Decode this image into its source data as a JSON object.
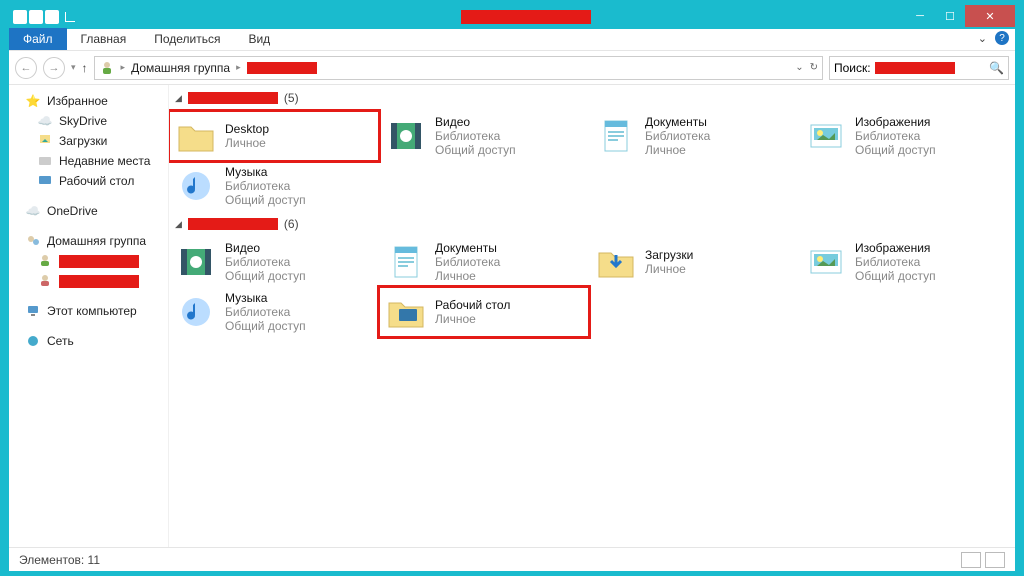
{
  "ribbon": {
    "file": "Файл",
    "tabs": [
      "Главная",
      "Поделиться",
      "Вид"
    ]
  },
  "breadcrumb": {
    "root": "Домашняя группа"
  },
  "search": {
    "label": "Поиск:"
  },
  "sidebar": {
    "fav": "Избранное",
    "favItems": [
      "SkyDrive",
      "Загрузки",
      "Недавние места",
      "Рабочий стол"
    ],
    "onedrive": "OneDrive",
    "hg": "Домашняя группа",
    "pc": "Этот компьютер",
    "net": "Сеть"
  },
  "groups": [
    {
      "count": "(5)",
      "items": [
        {
          "name": "Desktop",
          "l2": "Личное",
          "icon": "folder",
          "hl": true
        },
        {
          "name": "Видео",
          "l2": "Библиотека",
          "l3": "Общий доступ",
          "icon": "video"
        },
        {
          "name": "Документы",
          "l2": "Библиотека",
          "l3": "Личное",
          "icon": "doc"
        },
        {
          "name": "Изображения",
          "l2": "Библиотека",
          "l3": "Общий доступ",
          "icon": "img"
        },
        {
          "name": "Музыка",
          "l2": "Библиотека",
          "l3": "Общий доступ",
          "icon": "music"
        }
      ]
    },
    {
      "count": "(6)",
      "items": [
        {
          "name": "Видео",
          "l2": "Библиотека",
          "l3": "Общий доступ",
          "icon": "video"
        },
        {
          "name": "Документы",
          "l2": "Библиотека",
          "l3": "Личное",
          "icon": "doc"
        },
        {
          "name": "Загрузки",
          "l2": "Личное",
          "icon": "dl"
        },
        {
          "name": "Изображения",
          "l2": "Библиотека",
          "l3": "Общий доступ",
          "icon": "img"
        },
        {
          "name": "Музыка",
          "l2": "Библиотека",
          "l3": "Общий доступ",
          "icon": "music"
        },
        {
          "name": "Рабочий стол",
          "l2": "Личное",
          "icon": "desk",
          "hl": true
        }
      ]
    }
  ],
  "status": {
    "count": "Элементов: 11"
  }
}
